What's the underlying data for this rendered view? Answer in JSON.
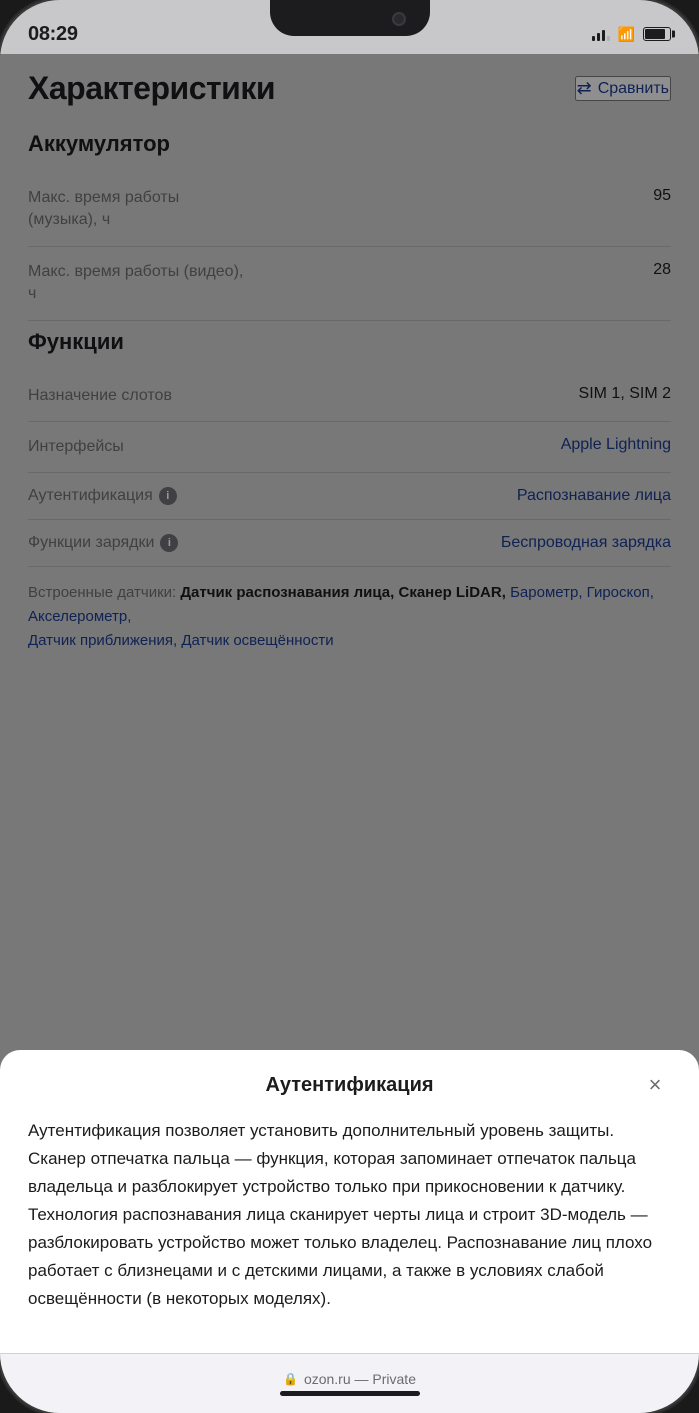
{
  "statusBar": {
    "time": "08:29"
  },
  "header": {
    "title": "Характеристики",
    "compareLabel": "Сравнить"
  },
  "sections": [
    {
      "id": "battery",
      "title": "Аккумулятор",
      "rows": [
        {
          "id": "music-time",
          "label": "Макс. время работы (музыка), ч",
          "value": "95",
          "isLink": false,
          "hasInfo": false
        },
        {
          "id": "video-time",
          "label": "Макс. время работы (видео), ч",
          "value": "28",
          "isLink": false,
          "hasInfo": false
        }
      ]
    },
    {
      "id": "features",
      "title": "Функции",
      "rows": [
        {
          "id": "slots",
          "label": "Назначение слотов",
          "value": "SIM 1, SIM 2",
          "isLink": false,
          "hasInfo": false
        },
        {
          "id": "interfaces",
          "label": "Интерфейсы",
          "value": "Apple Lightning",
          "isLink": true,
          "hasInfo": false
        },
        {
          "id": "auth",
          "label": "Аутентификация",
          "value": "Распознавание лица",
          "isLink": true,
          "hasInfo": true
        },
        {
          "id": "charging",
          "label": "Функции зарядки",
          "value": "Беспроводная зарядка",
          "isLink": true,
          "hasInfo": true
        }
      ]
    }
  ],
  "sensors": {
    "prefix": "Встроенные датчики:",
    "boldItems": [
      "Датчик распознавания лица,",
      "Сканер LiDAR,"
    ],
    "linkItems": [
      "Барометр,",
      "Гироскоп,",
      "Акселерометр,",
      "Датчик приближения,",
      "Датчик освещённости"
    ]
  },
  "modal": {
    "title": "Аутентификация",
    "closeLabel": "×",
    "body": "Аутентификация позволяет установить дополнительный уровень защиты. Сканер отпечатка пальца — функция, которая запоминает отпечаток пальца владельца и разблокирует устройство только при прикосновении к датчику. Технология распознавания лица сканирует черты лица и строит 3D-модель — разблокировать устройство может только владелец. Распознавание лиц плохо работает с близнецами и с детскими лицами, а также в условиях слабой освещённости (в некоторых моделях)."
  },
  "bottomBar": {
    "lockIcon": "🔒",
    "url": "ozon.ru",
    "separator": "—",
    "label": "Private"
  }
}
